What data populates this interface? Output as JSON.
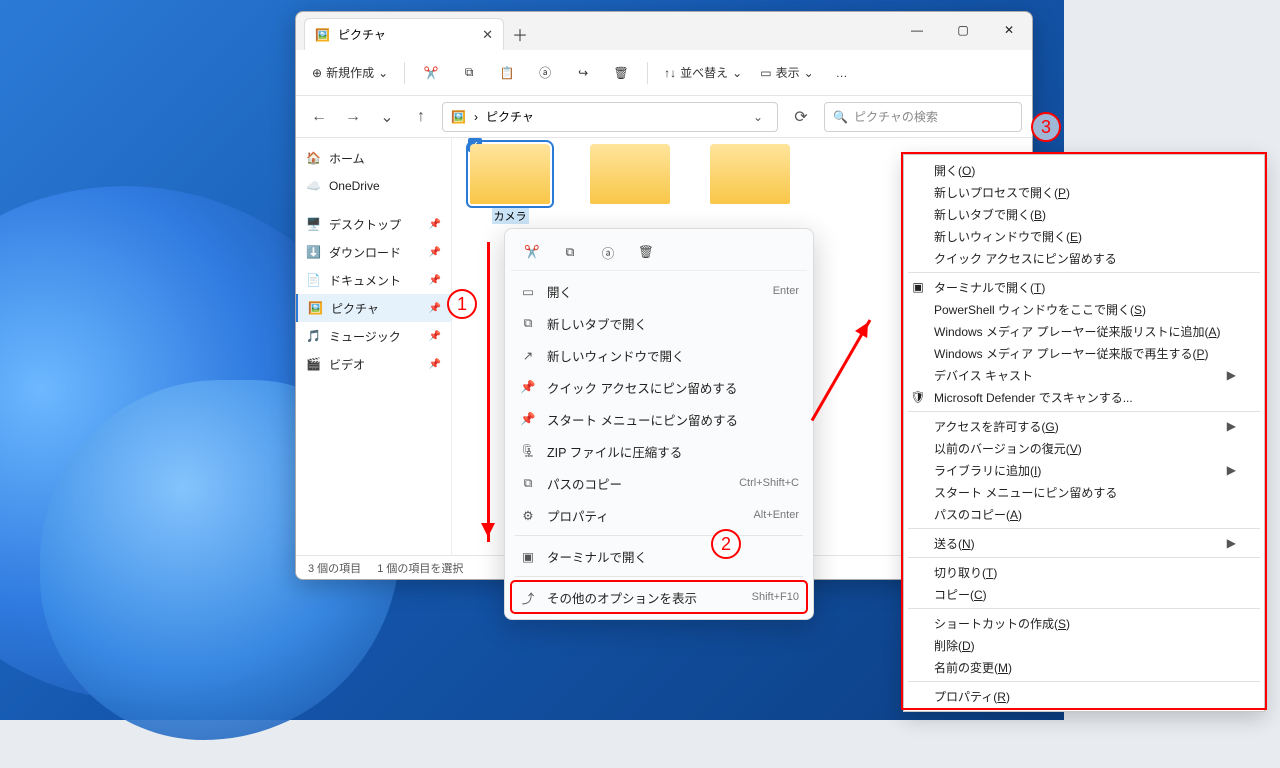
{
  "window": {
    "tab_title": "ピクチャ",
    "toolbar": {
      "new": "新規作成",
      "sort": "並べ替え",
      "view": "表示"
    },
    "breadcrumb": {
      "segments": [
        "ピクチャ"
      ]
    },
    "search_placeholder": "ピクチャの検索",
    "sidebar": [
      {
        "icon": "home-icon",
        "label": "ホーム"
      },
      {
        "icon": "onedrive-icon",
        "label": "OneDrive"
      },
      {
        "icon": "desktop-icon",
        "label": "デスクトップ",
        "pinned": true
      },
      {
        "icon": "download-icon",
        "label": "ダウンロード",
        "pinned": true
      },
      {
        "icon": "document-icon",
        "label": "ドキュメント",
        "pinned": true
      },
      {
        "icon": "pictures-icon",
        "label": "ピクチャ",
        "pinned": true,
        "active": true
      },
      {
        "icon": "music-icon",
        "label": "ミュージック",
        "pinned": true
      },
      {
        "icon": "video-icon",
        "label": "ビデオ",
        "pinned": true
      }
    ],
    "folders": [
      {
        "label": "カメラ",
        "selected": true
      },
      {
        "label": ""
      },
      {
        "label": ""
      }
    ],
    "status": {
      "items": "3 個の項目",
      "selected": "1 個の項目を選択"
    }
  },
  "ctx": {
    "items": [
      {
        "icon": "open-icon",
        "label": "開く",
        "shortcut": "Enter"
      },
      {
        "icon": "newtab-icon",
        "label": "新しいタブで開く"
      },
      {
        "icon": "newwin-icon",
        "label": "新しいウィンドウで開く"
      },
      {
        "icon": "pin-icon",
        "label": "クイック アクセスにピン留めする"
      },
      {
        "icon": "pin-icon",
        "label": "スタート メニューにピン留めする"
      },
      {
        "icon": "zip-icon",
        "label": "ZIP ファイルに圧縮する"
      },
      {
        "icon": "copypath-icon",
        "label": "パスのコピー",
        "shortcut": "Ctrl+Shift+C"
      },
      {
        "icon": "properties-icon",
        "label": "プロパティ",
        "shortcut": "Alt+Enter"
      },
      {
        "icon": "terminal-icon",
        "label": "ターミナルで開く",
        "sep_before": true
      },
      {
        "icon": "more-icon",
        "label": "その他のオプションを表示",
        "shortcut": "Shift+F10",
        "sep_before": true,
        "highlight": true
      }
    ]
  },
  "legacy": {
    "groups": [
      [
        {
          "label": "開く",
          "accel": "O"
        },
        {
          "label": "新しいプロセスで開く",
          "accel": "P"
        },
        {
          "label": "新しいタブで開く",
          "accel": "B"
        },
        {
          "label": "新しいウィンドウで開く",
          "accel": "E"
        },
        {
          "label": "クイック アクセスにピン留めする"
        }
      ],
      [
        {
          "icon": "terminal-icon",
          "label": "ターミナルで開く",
          "accel": "T"
        },
        {
          "label": "PowerShell ウィンドウをここで開く",
          "accel": "S"
        },
        {
          "label": "Windows メディア プレーヤー従来版リストに追加",
          "accel": "A"
        },
        {
          "label": "Windows メディア プレーヤー従来版で再生する",
          "accel": "P"
        },
        {
          "label": "デバイス キャスト",
          "submenu": true
        },
        {
          "icon": "shield-icon",
          "label": "Microsoft Defender でスキャンする..."
        }
      ],
      [
        {
          "label": "アクセスを許可する",
          "accel": "G",
          "submenu": true
        },
        {
          "label": "以前のバージョンの復元",
          "accel": "V"
        },
        {
          "label": "ライブラリに追加",
          "accel": "I",
          "submenu": true
        },
        {
          "label": "スタート メニューにピン留めする"
        },
        {
          "label": "パスのコピー",
          "accel": "A"
        }
      ],
      [
        {
          "label": "送る",
          "accel": "N",
          "submenu": true
        }
      ],
      [
        {
          "label": "切り取り",
          "accel": "T"
        },
        {
          "label": "コピー",
          "accel": "C"
        }
      ],
      [
        {
          "label": "ショートカットの作成",
          "accel": "S"
        },
        {
          "label": "削除",
          "accel": "D"
        },
        {
          "label": "名前の変更",
          "accel": "M"
        }
      ],
      [
        {
          "label": "プロパティ",
          "accel": "R"
        }
      ]
    ]
  },
  "annotations": {
    "n1": "1",
    "n2": "2",
    "n3": "3"
  }
}
